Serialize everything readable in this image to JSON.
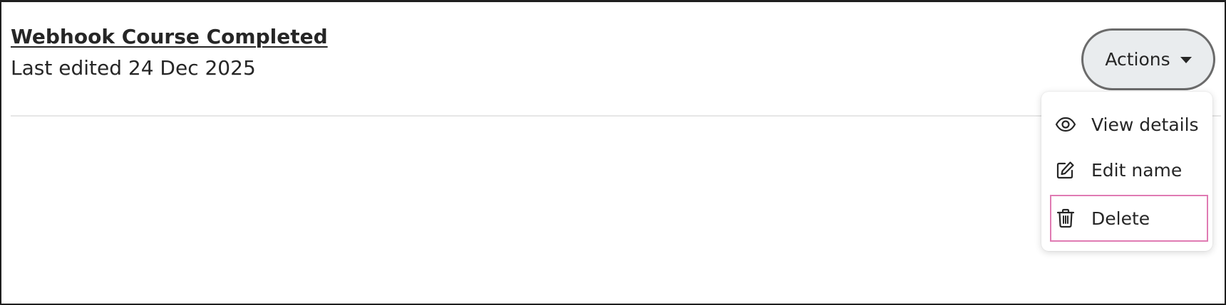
{
  "item": {
    "title": "Webhook Course Completed",
    "meta": "Last edited 24 Dec 2025"
  },
  "actions": {
    "label": "Actions",
    "caret_icon": "caret-down-icon"
  },
  "menu": {
    "items": [
      {
        "label": "View details",
        "icon": "eye-icon"
      },
      {
        "label": "Edit name",
        "icon": "edit-icon"
      },
      {
        "label": "Delete",
        "icon": "trash-icon",
        "highlighted": true
      }
    ]
  },
  "colors": {
    "text": "#262626",
    "button_bg": "#e9ecee",
    "button_border": "#6b6b6b",
    "highlight_border": "#e07bb3",
    "divider": "#e6e6e6"
  }
}
